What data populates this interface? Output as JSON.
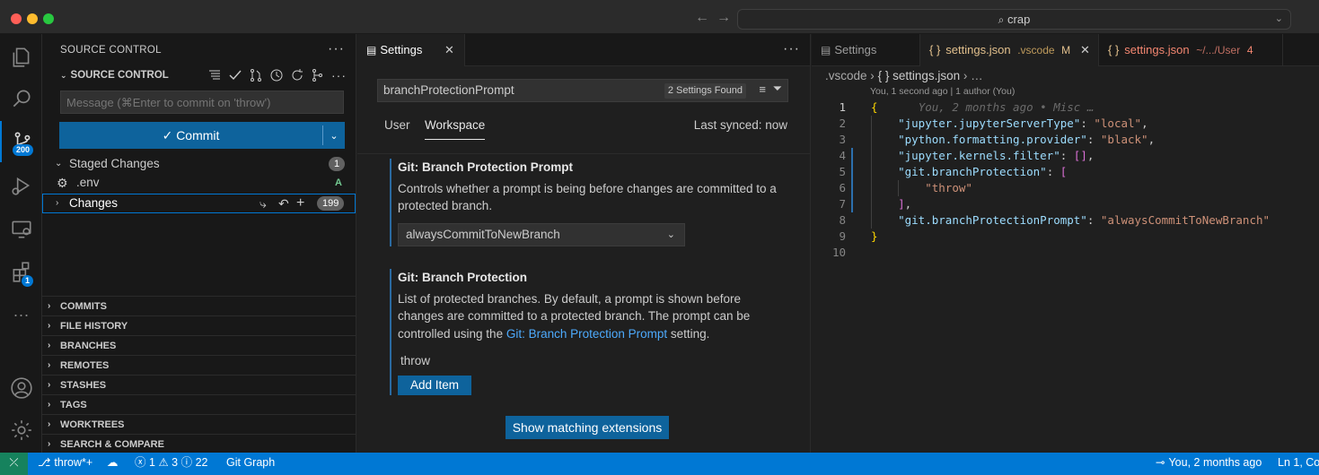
{
  "titlebar": {
    "search_text": "crap",
    "nav_back": "←",
    "nav_forward": "→"
  },
  "activity": {
    "scm_badge": "200",
    "extensions_badge": "1"
  },
  "sidebar": {
    "title": "SOURCE CONTROL",
    "section_title": "SOURCE CONTROL",
    "message_placeholder": "Message (⌘Enter to commit on 'throw')",
    "commit_label": "✓ Commit",
    "staged": {
      "label": "Staged Changes",
      "count": "1",
      "files": [
        {
          "name": ".env",
          "status": "A"
        }
      ]
    },
    "changes": {
      "label": "Changes",
      "count": "199"
    },
    "sections": [
      "COMMITS",
      "FILE HISTORY",
      "BRANCHES",
      "REMOTES",
      "STASHES",
      "TAGS",
      "WORKTREES",
      "SEARCH & COMPARE"
    ]
  },
  "settings": {
    "tab_label": "Settings",
    "search_value": "branchProtectionPrompt",
    "found_label": "2 Settings Found",
    "scope_tabs": [
      "User",
      "Workspace"
    ],
    "synced": "Last synced: now",
    "s1": {
      "category": "Git: ",
      "name": "Branch Protection Prompt",
      "desc": "Controls whether a prompt is being before changes are committed to a protected branch.",
      "value": "alwaysCommitToNewBranch"
    },
    "s2": {
      "category": "Git: ",
      "name": "Branch Protection",
      "desc_a": "List of protected branches. By default, a prompt is shown before changes are committed to a protected branch. The prompt can be controlled using the ",
      "link": "Git: Branch Protection Prompt",
      "desc_b": " setting.",
      "item": "throw",
      "add_label": "Add Item"
    },
    "ext_button": "Show matching extensions"
  },
  "editor": {
    "tabs": [
      {
        "label": "Settings"
      },
      {
        "label": "settings.json",
        "desc": ".vscode",
        "badge": "M"
      },
      {
        "label": "settings.json",
        "desc": "~/.../User",
        "badge": "4"
      }
    ],
    "breadcrumb": [
      ".vscode",
      "{ } settings.json",
      "…"
    ],
    "blame_header": "You, 1 second ago | 1 author (You)",
    "inline_blame": "You, 2 months ago • Misc …",
    "line_numbers": [
      "1",
      "2",
      "3",
      "4",
      "5",
      "6",
      "7",
      "8",
      "9",
      "10"
    ],
    "code": {
      "k1": "\"jupyter.jupyterServerType\"",
      "v1": "\"local\"",
      "k2": "\"python.formatting.provider\"",
      "v2": "\"black\"",
      "k3": "\"jupyter.kernels.filter\"",
      "v3": "[]",
      "k4": "\"git.branchProtection\"",
      "v4": "\"throw\"",
      "k5": "\"git.branchProtectionPrompt\"",
      "v5": "\"alwaysCommitToNewBranch\""
    }
  },
  "statusbar": {
    "remote": "⤫",
    "branch": "throw*+",
    "errors": "1",
    "warnings": "3",
    "info": "22",
    "git_graph": "Git Graph",
    "blame": "You, 2 months ago",
    "position": "Ln 1, Co"
  }
}
